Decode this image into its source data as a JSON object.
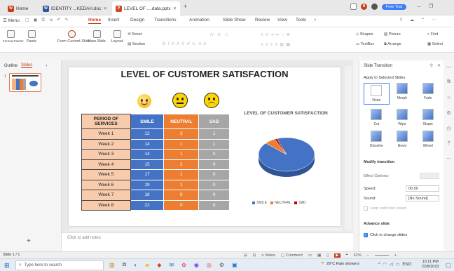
{
  "titlebar": {
    "home_tab": "Home",
    "doc_tab": "IDENTITY ...KEDAH.doc",
    "ppt_tab": "LEVEL OF ....data.pptx",
    "free_trial": "Free Trial"
  },
  "menubar": {
    "menu": "Menu",
    "items": [
      "Home",
      "Insert",
      "Design",
      "Transitions",
      "Animation",
      "Slide Show",
      "Review",
      "View",
      "Tools"
    ]
  },
  "toolbar": {
    "format_painter": "Format Painter",
    "paste": "Paste",
    "from_current_slide": "From Current Slide",
    "new_slide": "New Slide",
    "layout": "Layout",
    "reset": "Reset",
    "section": "Section",
    "shapes": "Shapes",
    "picture": "Picture",
    "find": "Find",
    "textbox": "TextBox",
    "arrange": "Arrange",
    "select": "Select"
  },
  "leftpanel": {
    "outline_tab": "Outline",
    "slides_tab": "Slides",
    "slide_number": "1"
  },
  "slide": {
    "title": "LEVEL OF CUSTOMER SATISFACTION",
    "table": {
      "headers": [
        "PERIOD OF SERVICES",
        "SMILE",
        "NEUTRAL",
        "SAD"
      ],
      "rows": [
        [
          "Week 1",
          "12",
          "3",
          "1"
        ],
        [
          "Week 2",
          "14",
          "1",
          "1"
        ],
        [
          "Week 3",
          "14",
          "1",
          "0"
        ],
        [
          "Week 4",
          "15",
          "2",
          "0"
        ],
        [
          "Week 5",
          "17",
          "1",
          "0"
        ],
        [
          "Week 6",
          "19",
          "1",
          "0"
        ],
        [
          "Week 7",
          "18",
          "0",
          "0"
        ],
        [
          "Week 8",
          "22",
          "0",
          "0"
        ]
      ]
    },
    "chart_title": "LEVEL OF CUSTOMER SATISFACTION",
    "legend": [
      "SMILE",
      "NEUTRAL",
      "SAD"
    ]
  },
  "chart_data": {
    "type": "pie",
    "title": "LEVEL OF CUSTOMER SATISFACTION",
    "categories": [
      "SMILE",
      "NEUTRAL",
      "SAD"
    ],
    "values": [
      131,
      9,
      2
    ],
    "colors": [
      "#4472c4",
      "#ed7d31",
      "#c00000"
    ]
  },
  "notes": {
    "placeholder": "Click to add notes"
  },
  "rightpanel": {
    "title": "Slide Transition",
    "apply_label": "Apply to Selected Slides",
    "transitions": [
      "None",
      "Morph",
      "Fade",
      "Cut",
      "Wipe",
      "Shape",
      "Dissolve",
      "News",
      "Wheel"
    ],
    "modify_label": "Modify transition",
    "effect_options": "Effect Options:",
    "speed_label": "Speed:",
    "speed_value": "00.50",
    "sound_label": "Sound:",
    "sound_value": "[No Sound]",
    "loop_label": "Loop until next sound",
    "advance_label": "Advance slide",
    "click_label": "Click to change slides"
  },
  "statusbar": {
    "slide_count": "Slide 1 / 1",
    "notes": "Notes",
    "comment": "Comment",
    "zoom": "62%"
  },
  "taskbar": {
    "search_placeholder": "Type here to search",
    "weather": "29°C  Rain showers",
    "lang": "ENG",
    "time": "10:11 PM",
    "date": "22/8/2023"
  },
  "colors": {
    "smile": "#4472c4",
    "neutral": "#ed7d31",
    "sad": "#a6a6a6",
    "accent": "#c43e1c"
  }
}
